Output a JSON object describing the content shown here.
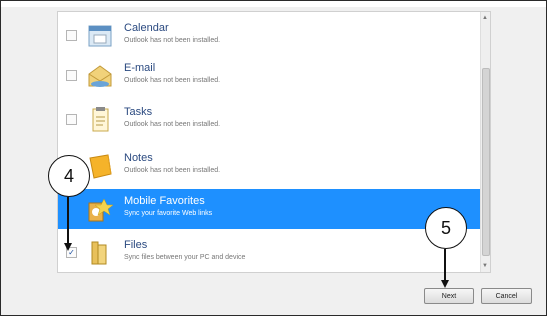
{
  "items": [
    {
      "name": "Calendar",
      "desc": "Outlook has not been installed.",
      "checked": false,
      "selected": false,
      "icon": "calendar-icon"
    },
    {
      "name": "E-mail",
      "desc": "Outlook has not been installed.",
      "checked": false,
      "selected": false,
      "icon": "email-icon"
    },
    {
      "name": "Tasks",
      "desc": "Outlook has not been installed.",
      "checked": false,
      "selected": false,
      "icon": "tasks-icon"
    },
    {
      "name": "Notes",
      "desc": "Outlook has not been installed.",
      "checked": false,
      "selected": false,
      "icon": "notes-icon"
    },
    {
      "name": "Mobile Favorites",
      "desc": "Sync your favorite Web links",
      "checked": false,
      "selected": true,
      "icon": "mobile-favorites-icon"
    },
    {
      "name": "Files",
      "desc": "Sync files between your PC and device",
      "checked": true,
      "selected": false,
      "icon": "files-icon"
    }
  ],
  "buttons": {
    "next": "Next",
    "cancel": "Cancel"
  },
  "callouts": {
    "c4": "4",
    "c5": "5"
  },
  "colors": {
    "selection": "#1e90ff"
  }
}
